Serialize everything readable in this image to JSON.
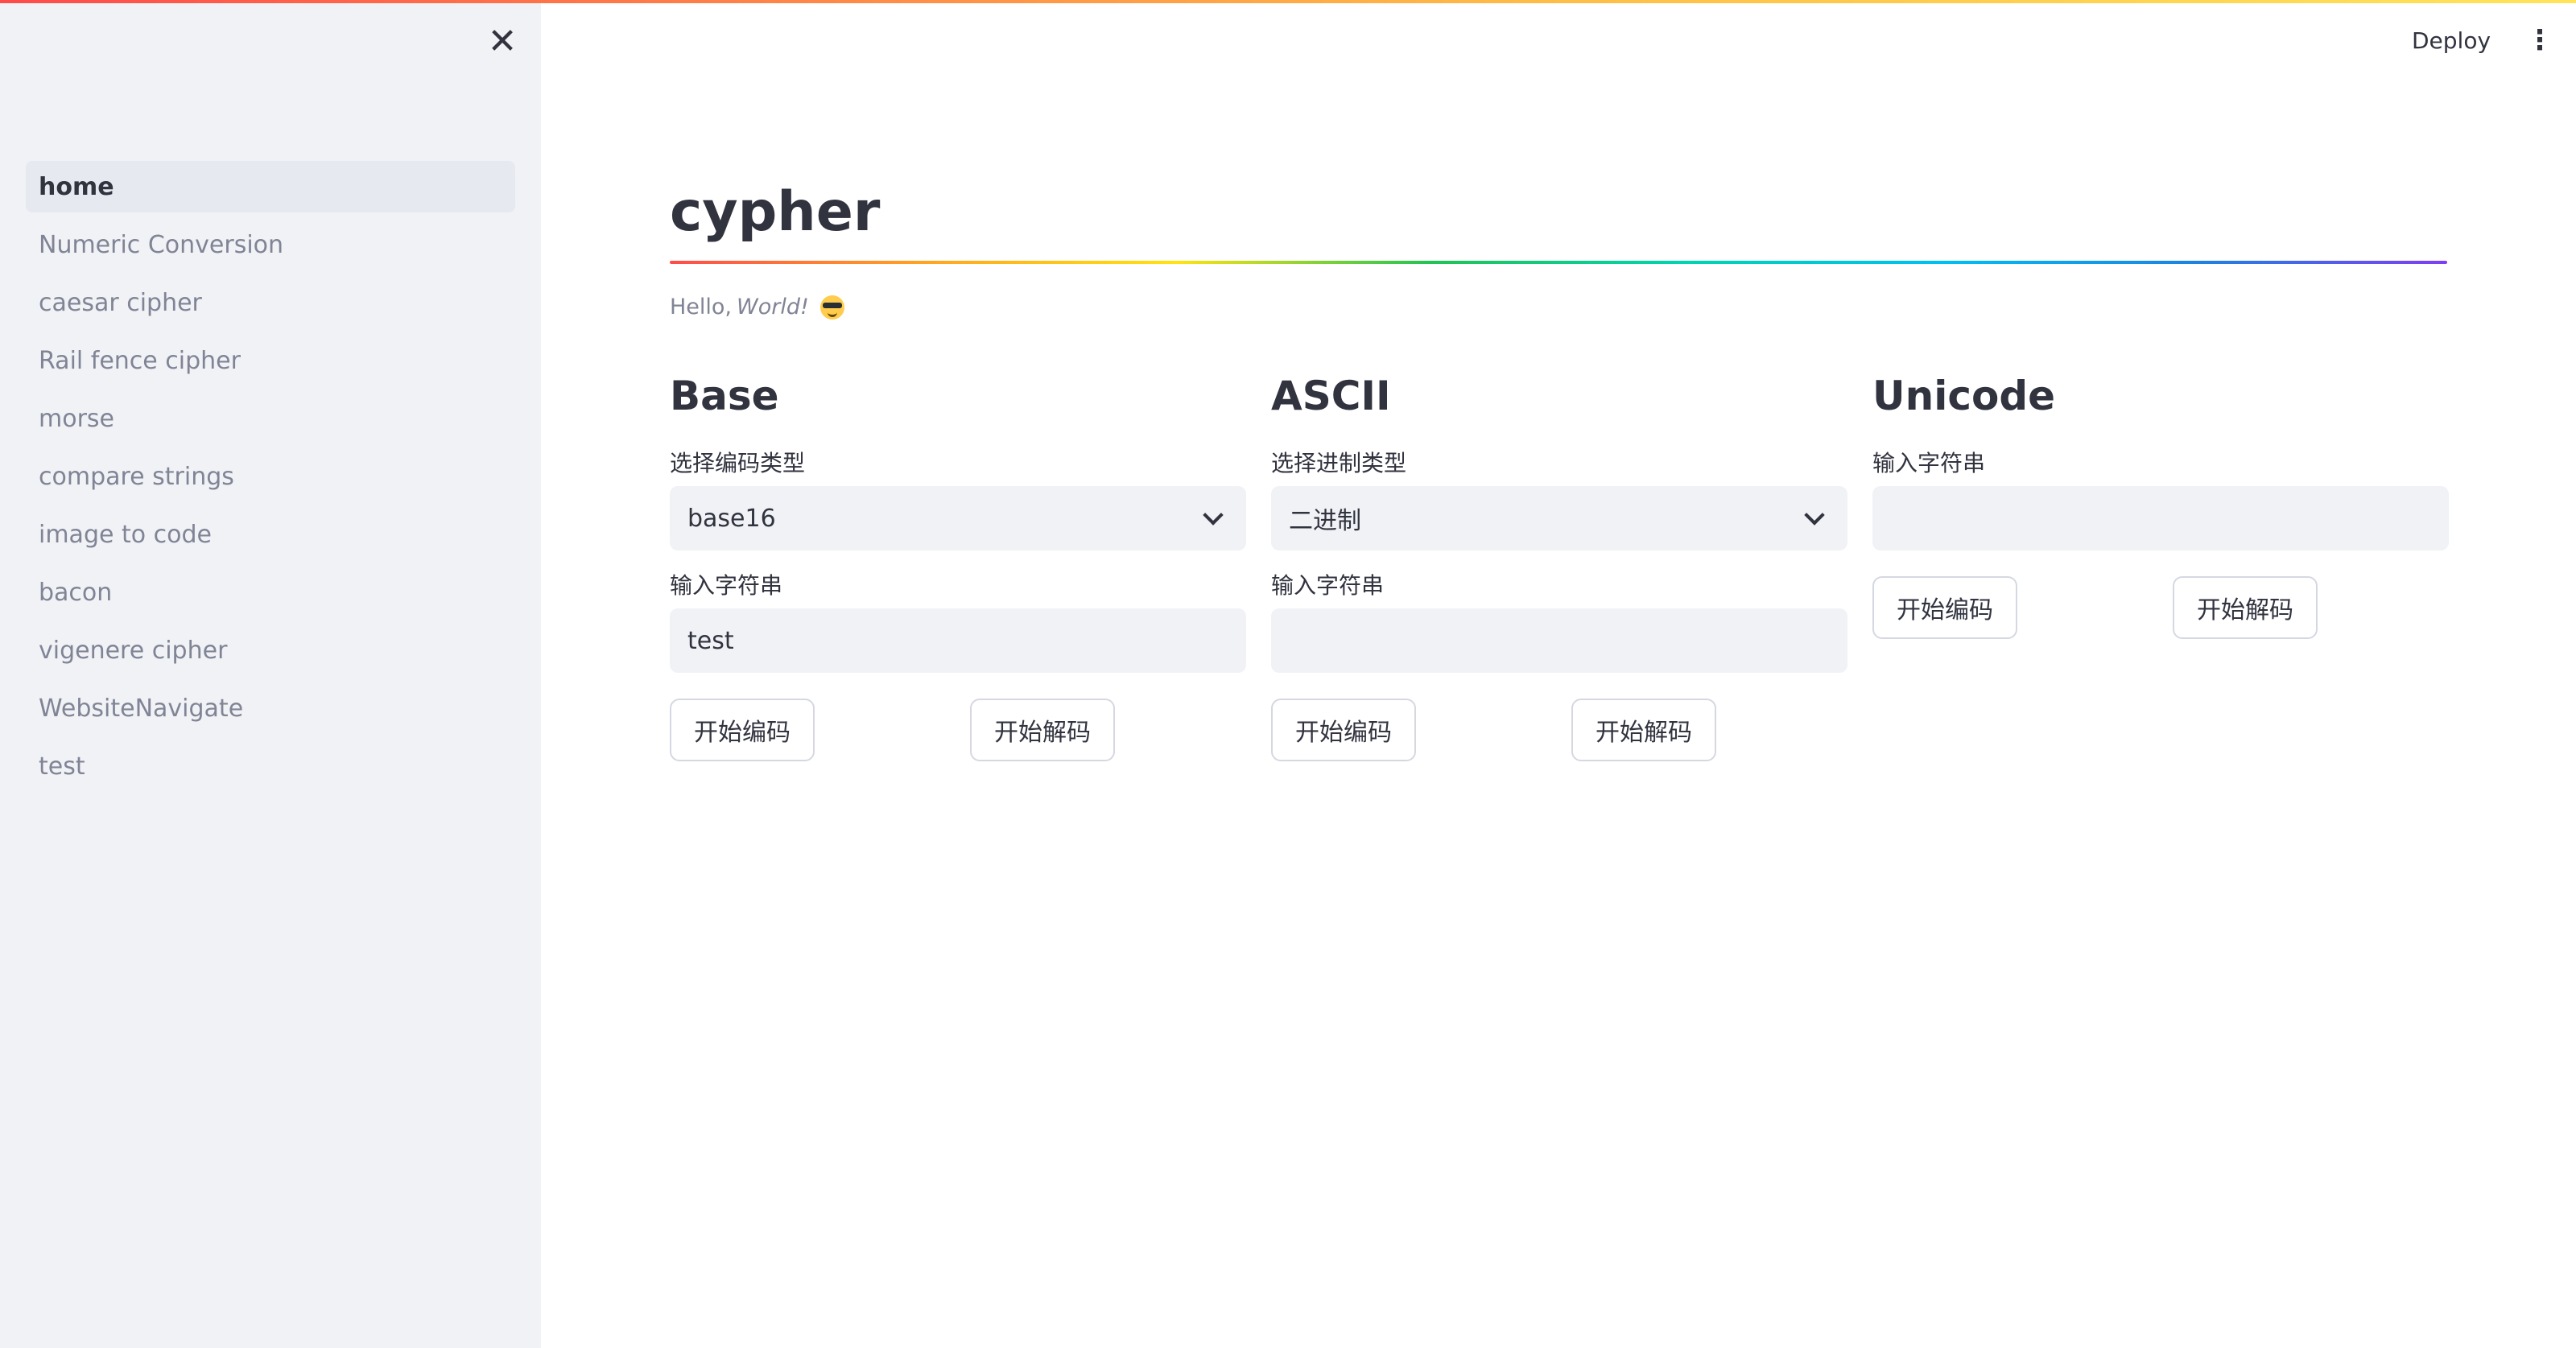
{
  "sidebar": {
    "close_icon": "close-icon",
    "items": [
      {
        "label": "home",
        "active": true
      },
      {
        "label": "Numeric Conversion"
      },
      {
        "label": "caesar cipher"
      },
      {
        "label": "Rail fence cipher"
      },
      {
        "label": "morse"
      },
      {
        "label": "compare strings"
      },
      {
        "label": "image to code"
      },
      {
        "label": "bacon"
      },
      {
        "label": "vigenere cipher"
      },
      {
        "label": "WebsiteNavigate"
      },
      {
        "label": "test"
      }
    ]
  },
  "header": {
    "deploy_label": "Deploy",
    "menu_icon": "more-vertical-icon"
  },
  "page": {
    "title": "cypher",
    "hello_prefix": "Hello, ",
    "hello_emphasis": "World!",
    "emoji_icon": "sunglasses-emoji-icon"
  },
  "base": {
    "heading": "Base",
    "select_label": "选择编码类型",
    "select_value": "base16",
    "input_label": "输入字符串",
    "input_value": "test",
    "encode_label": "开始编码",
    "decode_label": "开始解码"
  },
  "ascii": {
    "heading": "ASCII",
    "select_label": "选择进制类型",
    "select_value": "二进制",
    "input_label": "输入字符串",
    "input_value": "",
    "encode_label": "开始编码",
    "decode_label": "开始解码"
  },
  "unicode": {
    "heading": "Unicode",
    "input_label": "输入字符串",
    "input_value": "",
    "encode_label": "开始编码",
    "decode_label": "开始解码"
  },
  "colors": {
    "accent_top": "#ff4b4b",
    "sidebar_bg": "#f0f2f6",
    "text": "#31333f",
    "muted_text": "#808495"
  }
}
